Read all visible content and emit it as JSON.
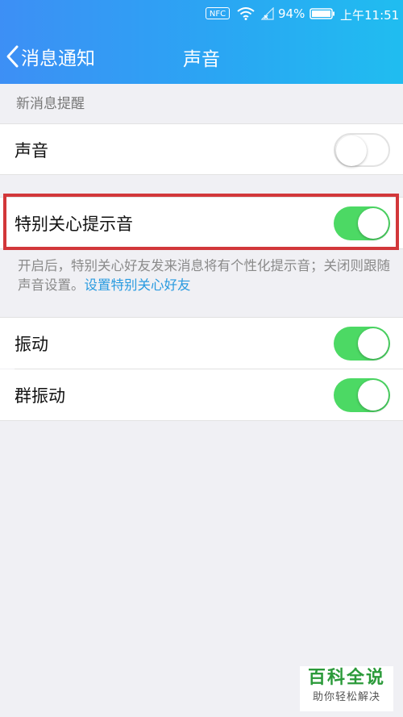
{
  "status_bar": {
    "nfc": "NFC",
    "battery_percent": "94%",
    "time": "上午11:51"
  },
  "header": {
    "back_label": "消息通知",
    "title": "声音"
  },
  "section": {
    "title": "新消息提醒"
  },
  "settings": {
    "sound": {
      "label": "声音",
      "enabled": false
    },
    "special_care_tone": {
      "label": "特别关心提示音",
      "enabled": true
    },
    "vibration": {
      "label": "振动",
      "enabled": true
    },
    "group_vibration": {
      "label": "群振动",
      "enabled": true
    }
  },
  "description": {
    "text": "开启后，特别关心好友发来消息将有个性化提示音；关闭则跟随声音设置。",
    "link": "设置特别关心好友"
  },
  "watermark": {
    "title": "百科全说",
    "subtitle": "助你轻松解决"
  },
  "colors": {
    "header_start": "#3d8ff5",
    "header_end": "#20bdf0",
    "toggle_on": "#4cd964",
    "highlight": "#d2373a",
    "link": "#2a9be0"
  }
}
